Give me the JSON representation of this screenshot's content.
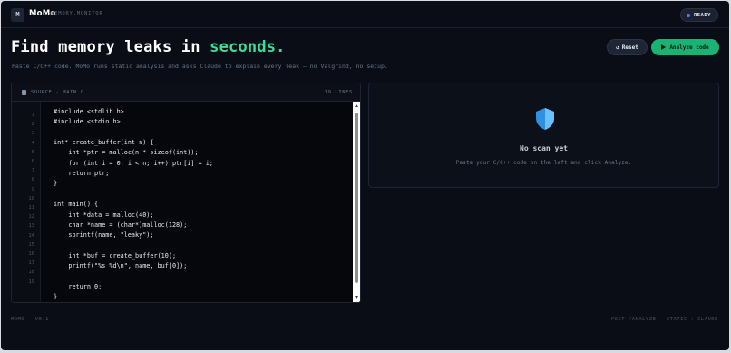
{
  "app": {
    "logo_glyph": "M",
    "brand": "MoMo",
    "brand_sub": "MEMORY.MONITOR",
    "status_label": "READY",
    "status_color": "#4f7cff",
    "accent_color": "#3ddc97"
  },
  "hero": {
    "headline_prefix": "Find memory leaks in ",
    "headline_accent": "seconds.",
    "subtitle": "Paste C/C++ code. MoMo runs static analysis and asks Claude to explain every leak — no Valgrind, no setup."
  },
  "actions": {
    "reset_icon": "↺",
    "reset_label": "Reset",
    "analyze_icon": "play-icon",
    "analyze_label": "Analyze code",
    "analyze_color": "#19b373"
  },
  "editor": {
    "title": "SOURCE - MAIN.C",
    "line_count": "19 LINES",
    "line_numbers": [
      "1",
      "2",
      "3",
      "4",
      "5",
      "6",
      "7",
      "8",
      "9",
      "10",
      "11",
      "12",
      "13",
      "14",
      "15",
      "16",
      "17",
      "18",
      "19"
    ],
    "code": [
      "#include <stdlib.h>",
      "#include <stdio.h>",
      "",
      "int* create_buffer(int n) {",
      "    int *ptr = malloc(n * sizeof(int));",
      "    for (int i = 0; i < n; i++) ptr[i] = i;",
      "    return ptr;",
      "}",
      "",
      "int main() {",
      "    int *data = malloc(40);",
      "    char *name = (char*)malloc(128);",
      "    sprintf(name, \"leaky\");",
      "",
      "    int *buf = create_buffer(10);",
      "    printf(\"%s %d\\n\", name, buf[0]);",
      "",
      "    return 0;",
      "}"
    ]
  },
  "results": {
    "icon": "shield-icon",
    "empty_title": "No scan yet",
    "empty_subtitle": "Paste your C/C++ code on the left and click Analyze."
  },
  "footer": {
    "left": "MOMO · V0.1",
    "right": "POST /ANALYZE → STATIC + CLAUDE"
  }
}
